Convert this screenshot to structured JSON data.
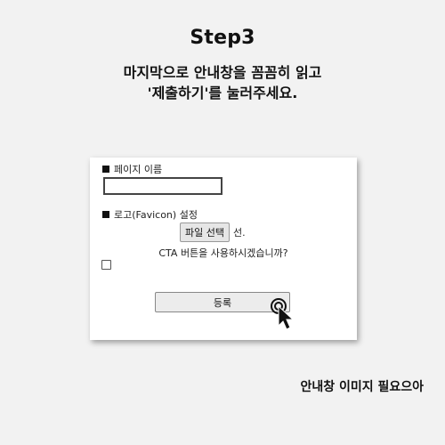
{
  "step": {
    "title": "Step3"
  },
  "instruction": {
    "line1": "마지막으로 안내창을 꼼꼼히 읽고",
    "line2": "'제출하기'를 눌러주세요."
  },
  "form": {
    "page_name_label": "페이지 이름",
    "page_name_value": "",
    "logo_label": "로고(Favicon) 설정",
    "file_button_label": "파일 선택",
    "file_status": "선.",
    "cta_question": "CTA 버튼을 사용하시겠습니까?",
    "submit_label": "등록"
  },
  "footer": {
    "note": "안내창 이미지 필요으아"
  },
  "colors": {
    "background": "#f2f2f2",
    "panel": "#ffffff",
    "text": "#111111"
  },
  "icons": {
    "cursor": "mouse-pointer-click-icon",
    "bullet": "square-bullet-icon"
  }
}
